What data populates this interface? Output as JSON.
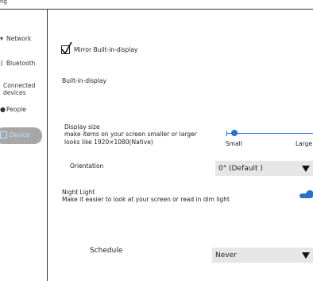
{
  "header": {
    "label": "ng"
  },
  "sidebar": {
    "items": [
      {
        "label": "Network",
        "icon": "wifi-icon"
      },
      {
        "label": "Bluetooth",
        "icon": "bluetooth-icon"
      },
      {
        "label": "Connected devices",
        "icon": "devices-icon"
      },
      {
        "label": "People",
        "icon": "person-icon"
      },
      {
        "label": "Device",
        "icon": "laptop-icon",
        "selected": true
      }
    ]
  },
  "display": {
    "mirror_label": "Mirror Built-in-display",
    "mirror_checked": true,
    "section_label": "Built-in-display",
    "size_title": "Display size",
    "size_desc_1": "make items on your screen smaller or larger",
    "size_desc_2": "looks like 1920×1080(Native)",
    "size_small": "Small",
    "size_large": "Large",
    "size_value": 0.08,
    "orientation_label": "Orientation",
    "orientation_value": "0° (Default )",
    "night_light_title": "Night Light",
    "night_light_desc": "Make it easier to look at your screen or read in dim light",
    "night_light_on": true,
    "schedule_label": "Schedule",
    "schedule_value": "Never"
  },
  "colors": {
    "accent": "#2a6fd1",
    "selected_bg": "#a7a7a7",
    "dropdown_bg": "#e6e6e6"
  }
}
